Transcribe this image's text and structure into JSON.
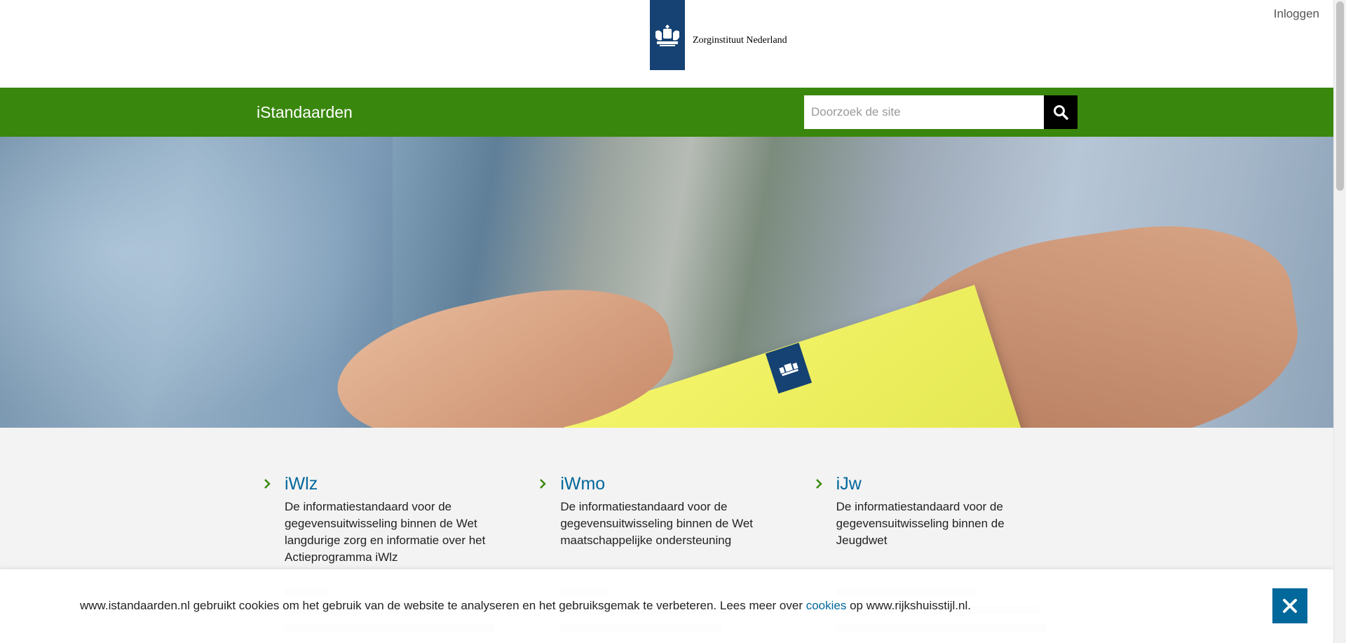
{
  "header": {
    "org_name": "Zorginstituut Nederland",
    "login_label": "Inloggen",
    "logo_icon": "rijkslogo-icon"
  },
  "navbar": {
    "site_title": "iStandaarden",
    "search_placeholder": "Doorzoek de site",
    "search_icon": "search-icon",
    "color": "#39870c"
  },
  "hero": {
    "image": "hands-passing-yellow-envelope-photo"
  },
  "cards": [
    {
      "title": "iWlz",
      "description": "De informatiestandaard voor de gegevensuitwisseling binnen de Wet langdurige zorg en informatie over het Actieprogramma iWlz"
    },
    {
      "title": "iWmo",
      "description": "De informatiestandaard voor de gegevensuitwisseling binnen de Wet maatschappelijke ondersteuning"
    },
    {
      "title": "iJw",
      "description": "De informatiestandaard voor de gegevensuitwisseling binnen de Jeugdwet"
    }
  ],
  "cookie_banner": {
    "text_before": "www.istandaarden.nl gebruikt cookies om het gebruik van de website te analyseren en het gebruiksgemak te verbeteren. Lees meer over ",
    "link_label": "cookies",
    "text_after": " op www.rijkshuisstijl.nl.",
    "close_icon": "close-icon"
  },
  "colors": {
    "link": "#01689b",
    "brand_blue": "#154273",
    "green": "#39870c"
  }
}
